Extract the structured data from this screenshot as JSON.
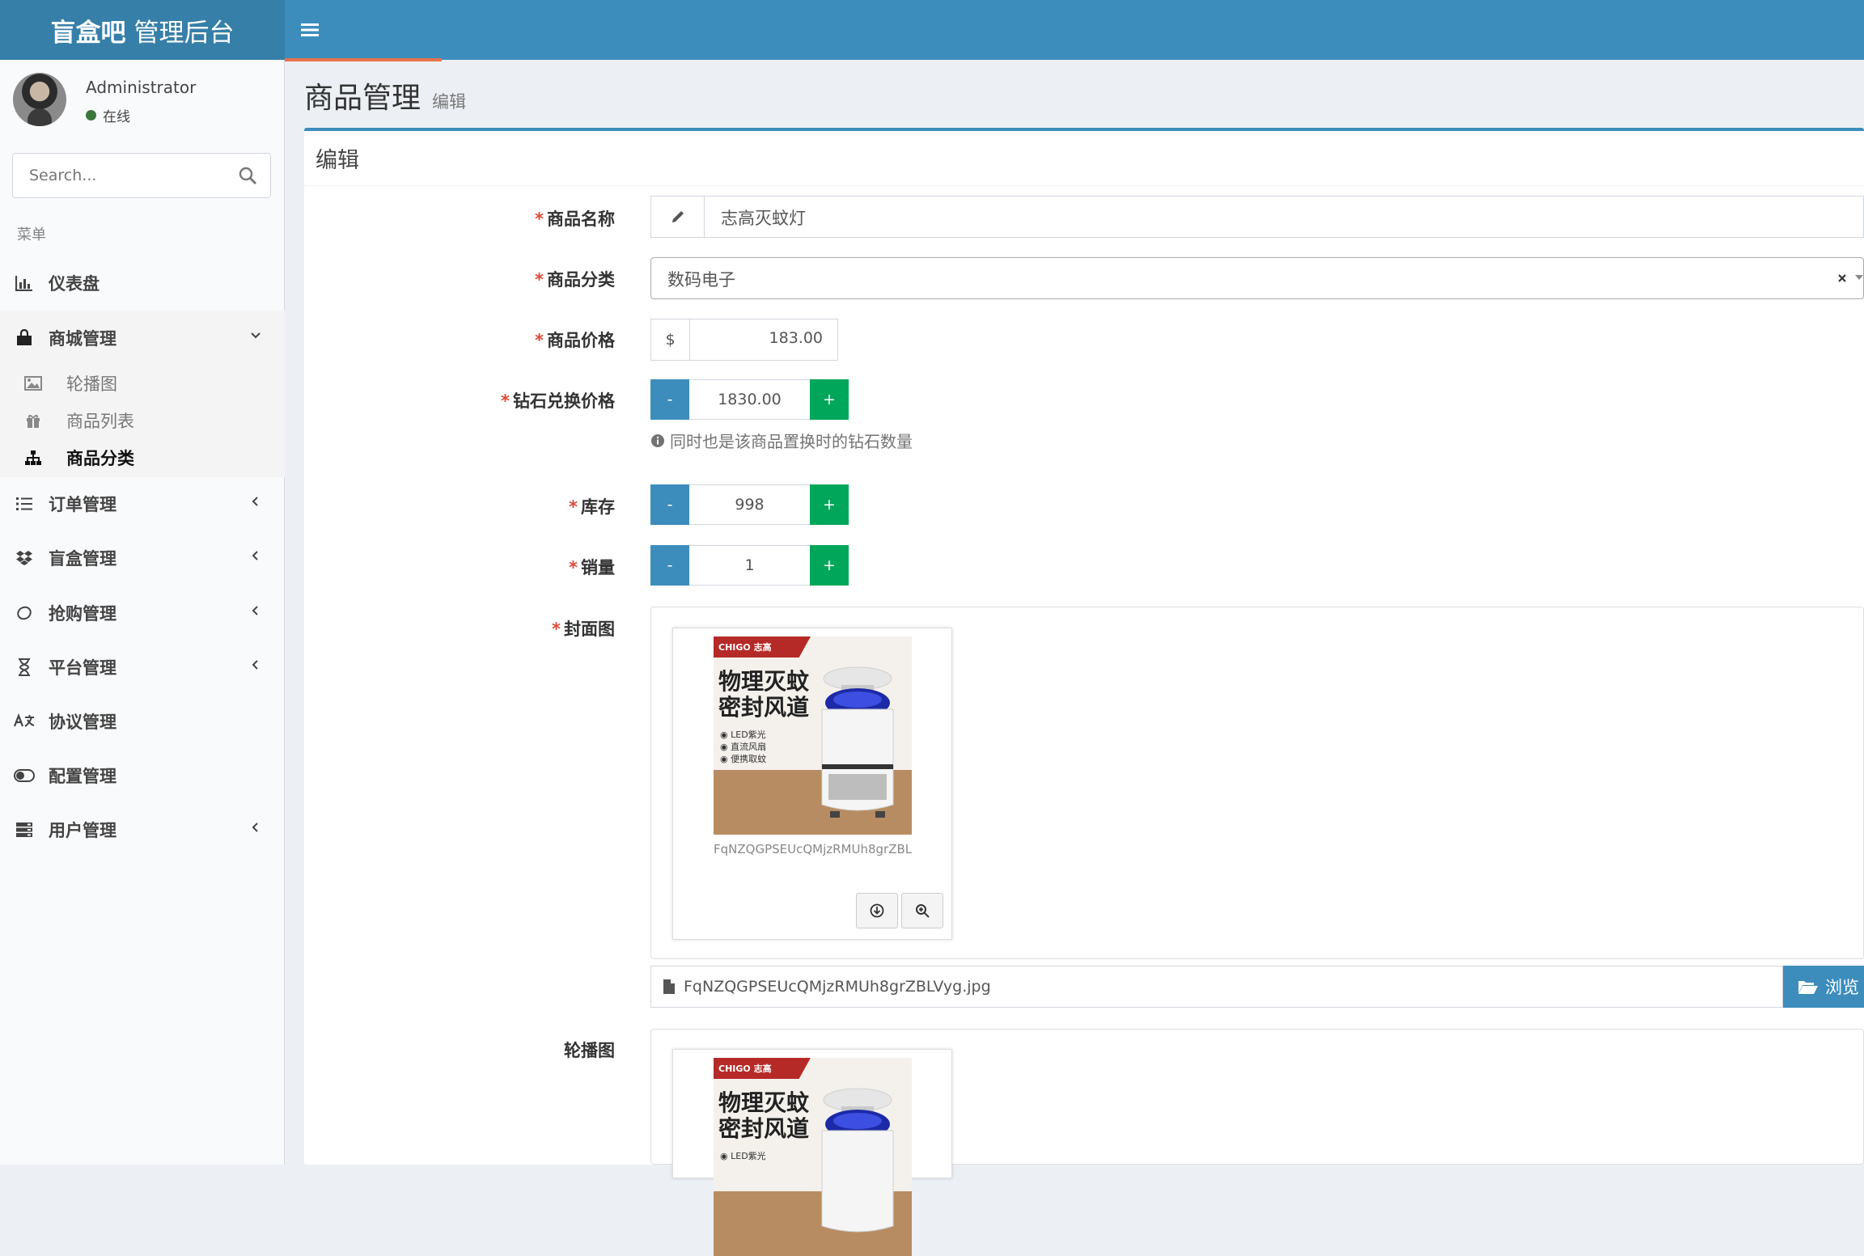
{
  "header": {
    "logo_bold": "盲盒吧",
    "logo_light": "管理后台",
    "toggle_icon": "bars-icon"
  },
  "sidebar": {
    "user_name": "Administrator",
    "user_status": "在线",
    "search_placeholder": "Search...",
    "menu_header": "菜单",
    "items": [
      {
        "label": "仪表盘",
        "icon": "bar-chart-icon"
      },
      {
        "label": "商城管理",
        "icon": "shopping-bag-icon"
      },
      {
        "label": "订单管理",
        "icon": "list-icon"
      },
      {
        "label": "盲盒管理",
        "icon": "dropbox-icon"
      },
      {
        "label": "抢购管理",
        "icon": "lemon-icon"
      },
      {
        "label": "平台管理",
        "icon": "hourglass-icon"
      },
      {
        "label": "协议管理",
        "icon": "language-icon"
      },
      {
        "label": "配置管理",
        "icon": "toggle-icon"
      },
      {
        "label": "用户管理",
        "icon": "server-icon"
      }
    ],
    "sub_items": [
      {
        "label": "轮播图",
        "icon": "image-icon"
      },
      {
        "label": "商品列表",
        "icon": "gift-icon"
      },
      {
        "label": "商品分类",
        "icon": "sitemap-icon"
      }
    ]
  },
  "page": {
    "title": "商品管理",
    "subtitle": "编辑",
    "box_title": "编辑"
  },
  "form": {
    "name_label": "商品名称",
    "name_value": "志高灭蚊灯",
    "category_label": "商品分类",
    "category_value": "数码电子",
    "price_label": "商品价格",
    "price_prefix": "$",
    "price_value": "183.00",
    "diamond_label": "钻石兑换价格",
    "diamond_value": "1830.00",
    "diamond_help": "同时也是该商品置换时的钻石数量",
    "stock_label": "库存",
    "stock_value": "998",
    "sales_label": "销量",
    "sales_value": "1",
    "minus": "-",
    "plus": "+",
    "cover_label": "封面图",
    "cover_caption": "FqNZQGPSEUcQMjzRMUh8grZBL...",
    "cover_filename": "FqNZQGPSEUcQMjzRMUh8grZBLVyg.jpg",
    "browse_label": "浏览",
    "carousel_label": "轮播图"
  },
  "poster": {
    "brand": "CHIGO 志高",
    "headline_1": "物理灭蚊",
    "headline_2": "密封风道",
    "bullet_1": "LED紫光",
    "bullet_2": "直流风扇",
    "bullet_3": "便携取蚊"
  },
  "colors": {
    "header": "#3c8dbc",
    "logo_bg": "#367fa9",
    "minus_btn": "#3c8dbc",
    "plus_btn": "#00a65a",
    "required": "#dd4b39"
  }
}
